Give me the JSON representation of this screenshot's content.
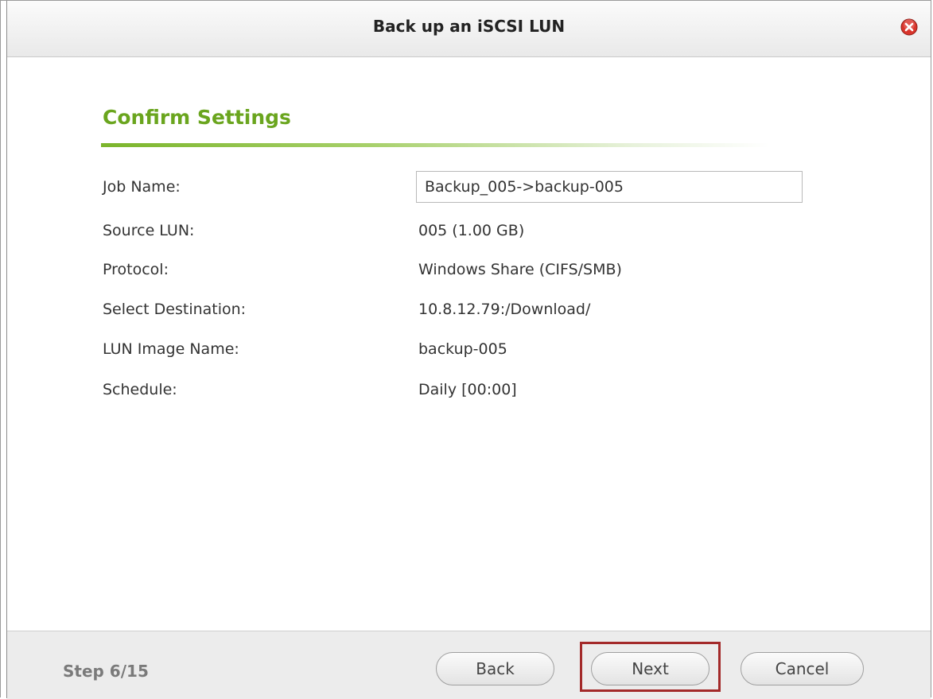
{
  "dialog": {
    "title": "Back up an iSCSI LUN",
    "close_icon": "close-icon"
  },
  "section": {
    "title": "Confirm Settings"
  },
  "fields": {
    "job_name_label": "Job Name:",
    "job_name_value": "Backup_005->backup-005",
    "source_lun_label": "Source LUN:",
    "source_lun_value": "005 (1.00 GB)",
    "protocol_label": "Protocol:",
    "protocol_value": "Windows Share (CIFS/SMB)",
    "destination_label": "Select Destination:",
    "destination_value": "10.8.12.79:/Download/",
    "image_name_label": "LUN Image Name:",
    "image_name_value": "backup-005",
    "schedule_label": "Schedule:",
    "schedule_value": "Daily [00:00]"
  },
  "footer": {
    "step": "Step 6/15",
    "back_label": "Back",
    "next_label": "Next",
    "cancel_label": "Cancel"
  },
  "colors": {
    "accent": "#6aa51e",
    "close": "#d9342b",
    "highlight": "#a32a2a"
  }
}
